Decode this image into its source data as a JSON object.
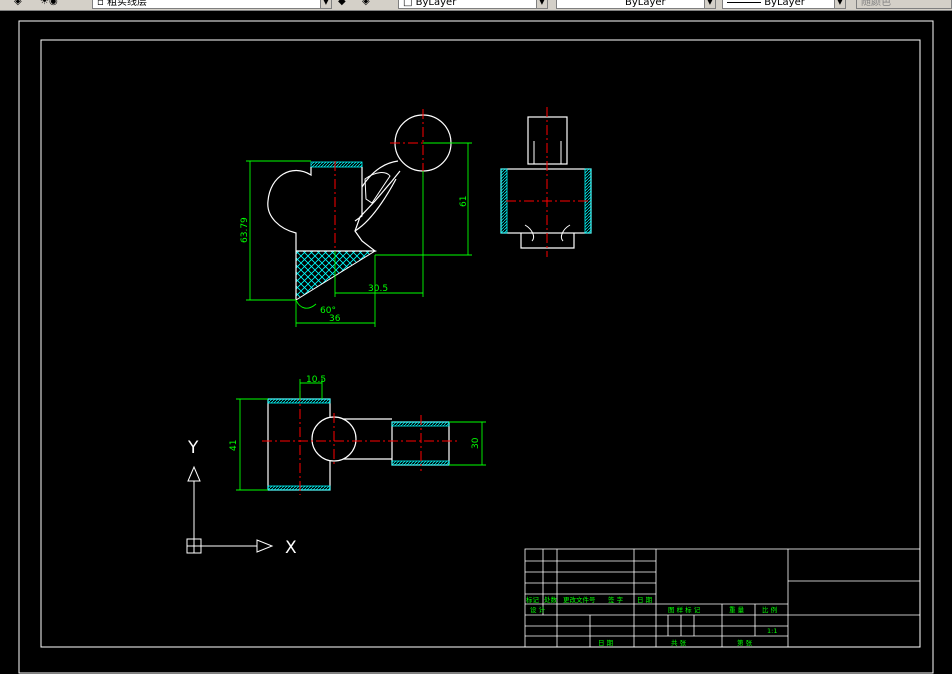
{
  "toolbar": {
    "layer_name": "粗实线层",
    "color_value": "ByLayer",
    "linetype_value": "ByLayer",
    "lineweight_value": "ByLayer",
    "plotstyle_value": "随颜色"
  },
  "drawing": {
    "dims": {
      "top_height": "63.79",
      "top_right": "61",
      "top_h1": "30.5",
      "top_angle": "60°",
      "top_width": "36",
      "bottom_top": "10.5",
      "bottom_left": "41",
      "bottom_right": "30"
    },
    "ucs": {
      "x_label": "X",
      "y_label": "Y"
    }
  },
  "title_block": {
    "row_labels": [
      "标记",
      "处数",
      "更改文件号",
      "签 字",
      "日 期"
    ],
    "design_label": "设 计",
    "approve_label": "日 期",
    "stage_label": "图 样 标 记",
    "weight_label": "重 量",
    "scale_label": "比 例",
    "scale_value": "1:1",
    "sheet_total": "共   张",
    "sheet_num": "第   张"
  },
  "colors": {
    "background": "#000000",
    "outline": "#ffffff",
    "dimension": "#00ff00",
    "centerline": "#ff0000",
    "hatch": "#00ffff"
  }
}
